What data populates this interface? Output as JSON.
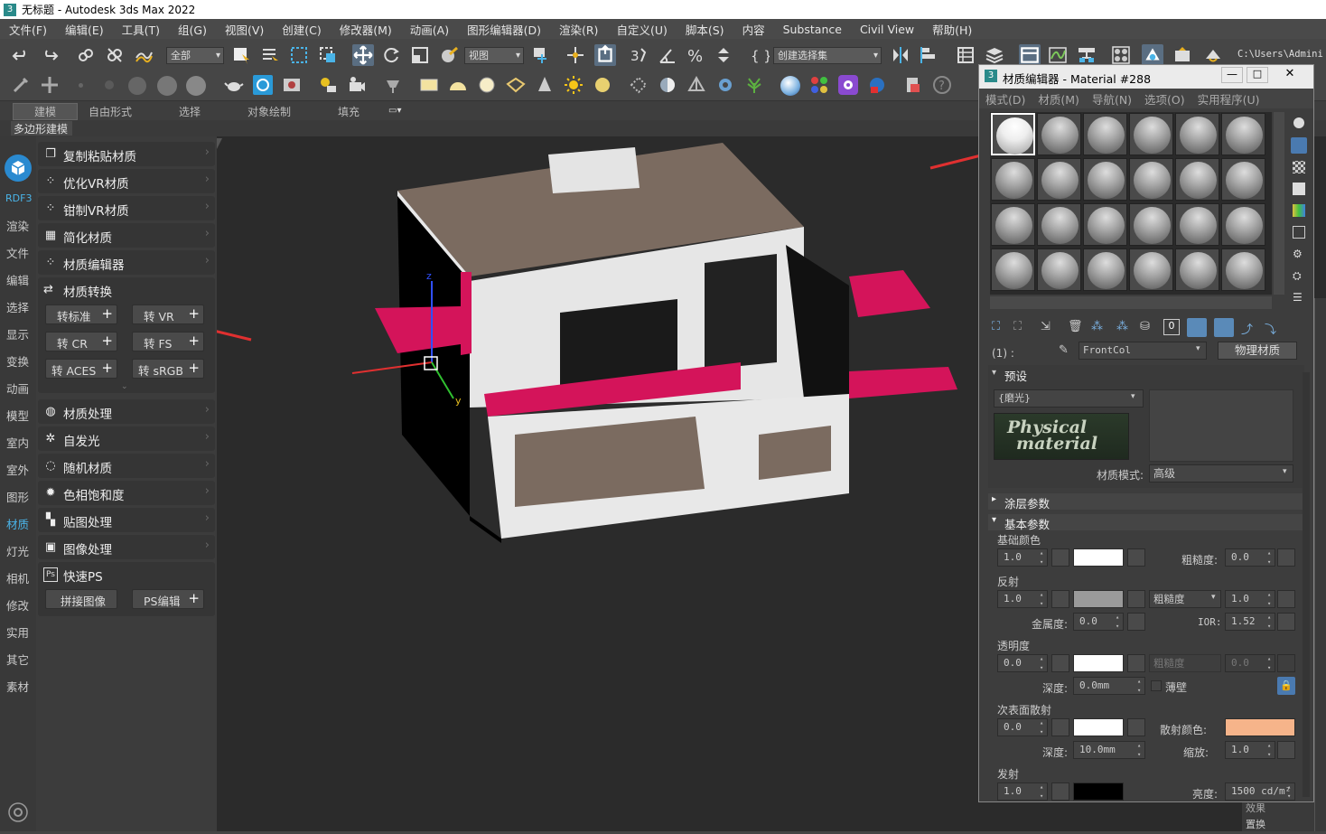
{
  "title": "无标题 - Autodesk 3ds Max 2022",
  "menu": [
    "文件(F)",
    "编辑(E)",
    "工具(T)",
    "组(G)",
    "视图(V)",
    "创建(C)",
    "修改器(M)",
    "动画(A)",
    "图形编辑器(D)",
    "渲染(R)",
    "自定义(U)",
    "脚本(S)",
    "内容",
    "Substance",
    "Civil View",
    "帮助(H)"
  ],
  "toolbar": {
    "select_filter": "全部",
    "view_dropdown": "视图",
    "named_selection": "创建选择集",
    "path": "C:\\Users\\Admini"
  },
  "ribbon": {
    "tabs": [
      "建模",
      "自由形式",
      "选择",
      "对象绘制",
      "填充"
    ],
    "subtab": "多边形建模"
  },
  "left_strip": {
    "logo": "RDF3",
    "items": [
      "渲染",
      "文件",
      "编辑",
      "选择",
      "显示",
      "变换",
      "动画",
      "模型",
      "室内",
      "室外",
      "图形",
      "材质",
      "灯光",
      "相机",
      "修改",
      "实用",
      "其它",
      "素材"
    ]
  },
  "panel": {
    "top_items": [
      "复制粘贴材质",
      "优化VR材质",
      "钳制VR材质",
      "简化材质",
      "材质编辑器",
      "材质转换"
    ],
    "convert_buttons": [
      "转标准",
      "转 VR",
      "转 CR",
      "转 FS",
      "转 ACES",
      "转 sRGB"
    ],
    "bottom_items": [
      "材质处理",
      "自发光",
      "随机材质",
      "色相饱和度",
      "贴图处理",
      "图像处理",
      "快速PS"
    ],
    "ps_buttons": [
      "拼接图像",
      "PS编辑"
    ]
  },
  "mat_editor": {
    "title": "材质编辑器 - Material #288",
    "menu": [
      "模式(D)",
      "材质(M)",
      "导航(N)",
      "选项(O)",
      "实用程序(U)"
    ],
    "slot_label": "(1) :",
    "material_name": "FrontCol",
    "material_type": "物理材质",
    "presets_header": "预设",
    "preset_value": "{磨光}",
    "logo_text_1": "Physical",
    "logo_text_2": "material",
    "mode_label": "材质模式:",
    "mode_value": "高级",
    "coating_header": "涂层参数",
    "basic_header": "基本参数",
    "base_color": {
      "label": "基础颜色",
      "weight": "1.0",
      "roughness_label": "粗糙度:",
      "roughness": "0.0"
    },
    "reflection": {
      "label": "反射",
      "weight": "1.0",
      "mode": "粗糙度",
      "value": "1.0",
      "metal_label": "金属度:",
      "metalness": "0.0",
      "ior_label": "IOR:",
      "ior": "1.52"
    },
    "transparency": {
      "label": "透明度",
      "weight": "0.0",
      "mode": "粗糙度",
      "value": "0.0",
      "depth_label": "深度:",
      "depth": "0.0mm",
      "thin_label": "薄壁"
    },
    "sss": {
      "label": "次表面散射",
      "weight": "0.0",
      "scatter_label": "散射颜色:",
      "depth_label": "深度:",
      "depth": "10.0mm",
      "scale_label": "缩放:",
      "scale": "1.0"
    },
    "emission": {
      "label": "发射",
      "weight": "1.0",
      "lum_label": "亮度:",
      "luminance": "1500 cd/m²"
    }
  },
  "right_edge": {
    "items": [
      "效果",
      "置换"
    ]
  },
  "colors": {
    "base": "#ffffff",
    "reflection": "#9a9a9a",
    "transparency": "#ffffff",
    "sss": "#ffffff",
    "scatter": "#f6b48a",
    "emission": "#000000",
    "accent": "#d4145a",
    "pointer": "#e03030"
  }
}
